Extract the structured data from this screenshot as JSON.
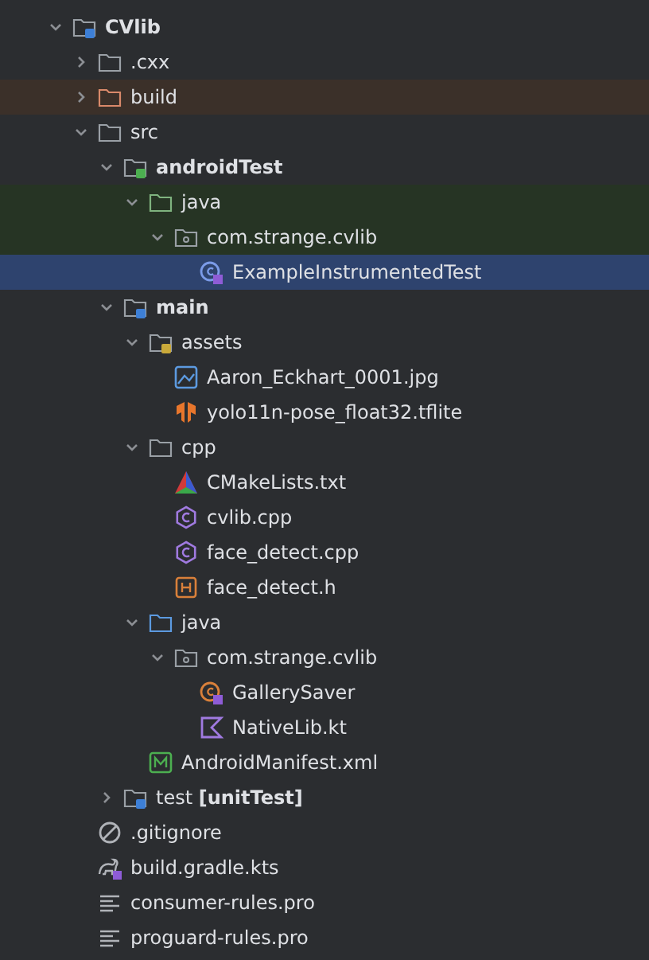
{
  "tree": [
    {
      "label": "CVlib",
      "bold": true,
      "kind": "module-folder",
      "expanded": true,
      "selected": false,
      "children": [
        {
          "label": ".cxx",
          "kind": "folder",
          "expanded": false,
          "selected": false
        },
        {
          "label": "build",
          "kind": "excluded-folder",
          "expanded": false,
          "selected": false
        },
        {
          "label": "src",
          "kind": "folder",
          "expanded": true,
          "selected": false,
          "children": [
            {
              "label": "androidTest",
              "bold": true,
              "kind": "test-source-folder",
              "expanded": true,
              "selected": false,
              "children": [
                {
                  "label": "java",
                  "kind": "test-folder",
                  "expanded": true,
                  "selected": false,
                  "children": [
                    {
                      "label": "com.strange.cvlib",
                      "kind": "test-package",
                      "expanded": true,
                      "selected": false,
                      "children": [
                        {
                          "label": "ExampleInstrumentedTest",
                          "kind": "test-class",
                          "selected": true
                        }
                      ]
                    }
                  ]
                }
              ]
            },
            {
              "label": "main",
              "bold": true,
              "kind": "module-folder",
              "expanded": true,
              "selected": false,
              "children": [
                {
                  "label": "assets",
                  "kind": "resource-folder",
                  "expanded": true,
                  "selected": false,
                  "children": [
                    {
                      "label": "Aaron_Eckhart_0001.jpg",
                      "kind": "image",
                      "selected": false
                    },
                    {
                      "label": "yolo11n-pose_float32.tflite",
                      "kind": "tflite",
                      "selected": false
                    }
                  ]
                },
                {
                  "label": "cpp",
                  "kind": "folder",
                  "expanded": true,
                  "selected": false,
                  "children": [
                    {
                      "label": "CMakeLists.txt",
                      "kind": "cmake",
                      "selected": false
                    },
                    {
                      "label": "cvlib.cpp",
                      "kind": "cpp",
                      "selected": false
                    },
                    {
                      "label": "face_detect.cpp",
                      "kind": "cpp",
                      "selected": false
                    },
                    {
                      "label": "face_detect.h",
                      "kind": "header",
                      "selected": false
                    }
                  ]
                },
                {
                  "label": "java",
                  "kind": "source-folder",
                  "expanded": true,
                  "selected": false,
                  "children": [
                    {
                      "label": "com.strange.cvlib",
                      "kind": "package",
                      "expanded": true,
                      "selected": false,
                      "children": [
                        {
                          "label": "GallerySaver",
                          "kind": "kotlin-class",
                          "selected": false
                        },
                        {
                          "label": "NativeLib.kt",
                          "kind": "kotlin-file",
                          "selected": false
                        }
                      ]
                    }
                  ]
                },
                {
                  "label": "AndroidManifest.xml",
                  "kind": "manifest",
                  "selected": false
                }
              ]
            },
            {
              "label": "test **[unitTest]**",
              "kind": "unit-test-folder",
              "expanded": false,
              "selected": false
            }
          ]
        },
        {
          "label": ".gitignore",
          "kind": "ignore",
          "selected": false
        },
        {
          "label": "build.gradle.kts",
          "kind": "gradle",
          "selected": false
        },
        {
          "label": "consumer-rules.pro",
          "kind": "text",
          "selected": false
        },
        {
          "label": "proguard-rules.pro",
          "kind": "text",
          "selected": false
        }
      ]
    }
  ]
}
